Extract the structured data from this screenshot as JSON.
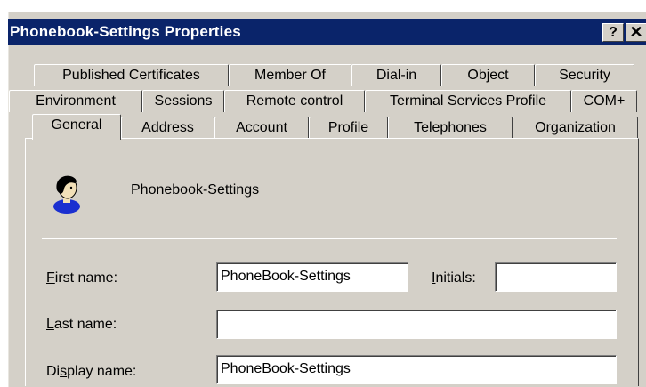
{
  "window": {
    "title": "Phonebook-Settings Properties",
    "help_label": "?",
    "close_label": "✕"
  },
  "tabs": {
    "row1": [
      "Published Certificates",
      "Member Of",
      "Dial-in",
      "Object",
      "Security"
    ],
    "row2": [
      "Environment",
      "Sessions",
      "Remote control",
      "Terminal Services Profile",
      "COM+"
    ],
    "row3": [
      "General",
      "Address",
      "Account",
      "Profile",
      "Telephones",
      "Organization"
    ],
    "active": "General"
  },
  "general": {
    "object_name": "Phonebook-Settings",
    "first_name": {
      "label_accel": "F",
      "label_rest": "irst name:",
      "value": "PhoneBook-Settings"
    },
    "initials": {
      "label_accel": "I",
      "label_rest": "nitials:",
      "value": ""
    },
    "last_name": {
      "label_accel": "L",
      "label_rest": "ast name:",
      "value": ""
    },
    "display_name": {
      "label_pre": "Di",
      "label_accel": "s",
      "label_rest": "play name:",
      "value": "PhoneBook-Settings"
    }
  },
  "icons": {
    "avatar": "user-avatar-icon"
  },
  "colors": {
    "titlebar": "#0a246a",
    "face": "#d4d0c8"
  }
}
